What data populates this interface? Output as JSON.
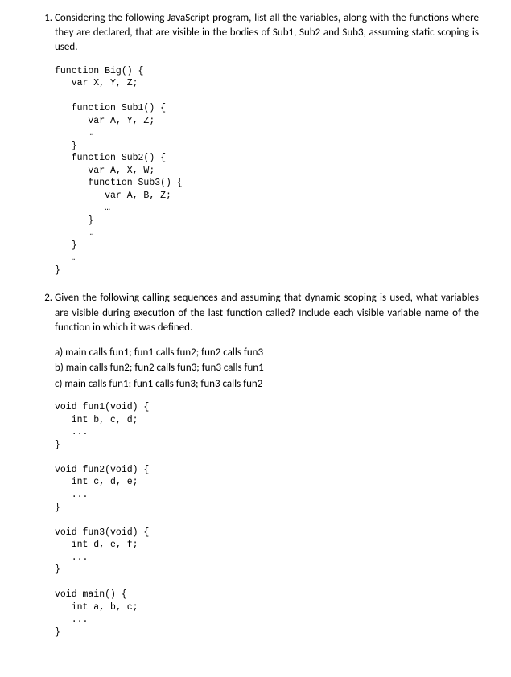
{
  "q1": {
    "text": "Considering the following JavaScript program, list all the variables, along with the functions where they are declared, that are visible in the bodies of Sub1, Sub2 and Sub3, assuming static scoping is used.",
    "code": "function Big() {\n   var X, Y, Z;\n\n   function Sub1() {\n      var A, Y, Z;\n      …\n   }\n   function Sub2() {\n      var A, X, W;\n      function Sub3() {\n         var A, B, Z;\n         …\n      }\n      …\n   }\n   …\n}"
  },
  "q2": {
    "text": "Given the following calling sequences and assuming that dynamic scoping is used, what variables are visible during execution of the last function called? Include each visible variable name of the function in which it was defined.",
    "a": "a) main calls fun1; fun1 calls fun2; fun2 calls fun3",
    "b": "b) main calls fun2; fun2 calls fun3; fun3 calls fun1",
    "c": "c) main calls fun1; fun1 calls fun3; fun3 calls fun2",
    "code": "void fun1(void) {\n   int b, c, d;\n   ...\n}\n\nvoid fun2(void) {\n   int c, d, e;\n   ...\n}\n\nvoid fun3(void) {\n   int d, e, f;\n   ...\n}\n\nvoid main() {\n   int a, b, c;\n   ...\n}"
  }
}
